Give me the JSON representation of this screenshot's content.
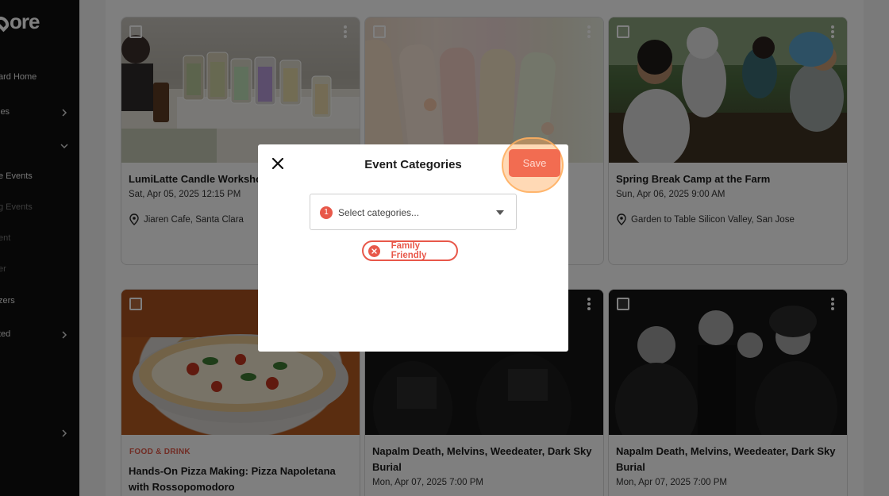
{
  "sidebar": {
    "logo": "ore",
    "items": [
      {
        "label": "ard Home"
      },
      {
        "label": "ies"
      },
      {
        "label": "e Events"
      },
      {
        "label": "g Events"
      },
      {
        "label": "ent"
      },
      {
        "label": "er"
      },
      {
        "label": "zers"
      },
      {
        "label": "ted"
      }
    ]
  },
  "cards": [
    {
      "title": "LumiLatte Candle Workshop",
      "date": "Sat, Apr 05, 2025 12:15 PM",
      "location": "Jiaren Cafe, Santa Clara"
    },
    {
      "title": "",
      "date": "",
      "location": ""
    },
    {
      "title": "Spring Break Camp at the Farm",
      "date": "Sun, Apr 06, 2025 9:00 AM",
      "location": "Garden to Table Silicon Valley, San Jose"
    },
    {
      "tag": "FOOD & DRINK",
      "title": "Hands-On Pizza Making: Pizza Napoletana with Rossopomodoro",
      "date": ""
    },
    {
      "title": "Napalm Death, Melvins, Weedeater, Dark Sky Burial",
      "date": "Mon, Apr 07, 2025 7:00 PM"
    },
    {
      "title": "Napalm Death, Melvins, Weedeater, Dark Sky Burial",
      "date": "Mon, Apr 07, 2025 7:00 PM"
    }
  ],
  "modal": {
    "title": "Event Categories",
    "save_label": "Save",
    "select_count": "1",
    "select_placeholder": "Select categories...",
    "selected_chip": "Family Friendly"
  },
  "colors": {
    "accent": "#f26c51",
    "chip": "#e8584a"
  }
}
